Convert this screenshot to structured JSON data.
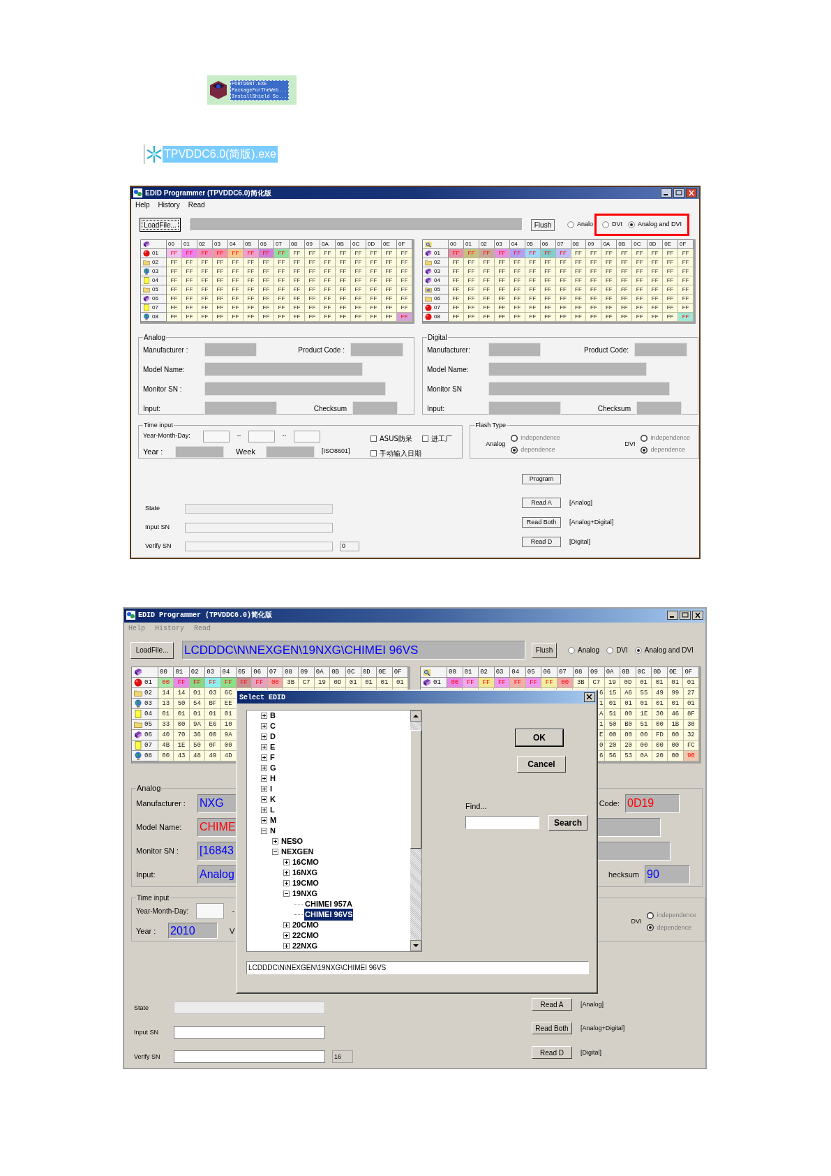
{
  "files": [
    {
      "kind": "package",
      "lines": [
        "PORT96NT.EXE",
        "PackageForTheWeb...",
        "InstallShield So..."
      ],
      "selected": true
    },
    {
      "kind": "app",
      "lines": [
        "TPVDDC6.0(简版).exe"
      ],
      "selected": true
    }
  ],
  "windows": [
    {
      "title": "EDID Programmer (TPVDDC6.0)简化版",
      "menu": [
        {
          "label": "Help",
          "disabled": false
        },
        {
          "label": "History",
          "disabled": false
        },
        {
          "label": "Read",
          "disabled": false
        }
      ],
      "load_button": "LoadFile...",
      "flush_button": "Flush",
      "mode_radios": [
        {
          "label": "Analo",
          "selected": false
        }
      ],
      "highlighted_radios": [
        {
          "label": "DVI",
          "selected": false
        },
        {
          "label": "Analog and DVI",
          "selected": true
        }
      ],
      "grids": [
        {
          "columns": [
            "00",
            "01",
            "02",
            "03",
            "04",
            "05",
            "06",
            "07",
            "08",
            "09",
            "0A",
            "0B",
            "0C",
            "0D",
            "0E",
            "0F"
          ],
          "rows": [
            {
              "label": "01",
              "cells": [
                {
                  "text": "FF",
                  "color": "#f0c0f0"
                },
                {
                  "text": "FF",
                  "color": "#f080f0"
                },
                {
                  "text": "FF",
                  "color": "#f090c0"
                },
                {
                  "text": "FF",
                  "color": "#f890a8"
                },
                {
                  "text": "FF",
                  "color": "#f8c890"
                },
                {
                  "text": "FF",
                  "color": "#f0a0d0"
                },
                {
                  "text": "FF",
                  "color": "#d080d8"
                },
                {
                  "text": "FF",
                  "color": "#90e0a0"
                },
                "FF",
                "FF",
                "FF",
                "FF",
                "FF",
                "FF",
                "FF",
                "FF"
              ]
            },
            {
              "label": "02",
              "cells": [
                "FF",
                "FF",
                "FF",
                "FF",
                "FF",
                "FF",
                "FF",
                "FF",
                "FF",
                "FF",
                "FF",
                "FF",
                "FF",
                "FF",
                "FF",
                "FF"
              ]
            },
            {
              "label": "03",
              "cells": [
                "FF",
                "FF",
                "FF",
                "FF",
                "FF",
                "FF",
                "FF",
                "FF",
                "FF",
                "FF",
                "FF",
                "FF",
                "FF",
                "FF",
                "FF",
                "FF"
              ]
            },
            {
              "label": "04",
              "cells": [
                "FF",
                "FF",
                "FF",
                "FF",
                "FF",
                "FF",
                "FF",
                "FF",
                "FF",
                "FF",
                "FF",
                "FF",
                "FF",
                "FF",
                "FF",
                "FF"
              ]
            },
            {
              "label": "05",
              "cells": [
                "FF",
                "FF",
                "FF",
                "FF",
                "FF",
                "FF",
                "FF",
                "FF",
                "FF",
                "FF",
                "FF",
                "FF",
                "FF",
                "FF",
                "FF",
                "FF"
              ]
            },
            {
              "label": "06",
              "cells": [
                "FF",
                "FF",
                "FF",
                "FF",
                "FF",
                "FF",
                "FF",
                "FF",
                "FF",
                "FF",
                "FF",
                "FF",
                "FF",
                "FF",
                "FF",
                "FF"
              ]
            },
            {
              "label": "07",
              "cells": [
                "FF",
                "FF",
                "FF",
                "FF",
                "FF",
                "FF",
                "FF",
                "FF",
                "FF",
                "FF",
                "FF",
                "FF",
                "FF",
                "FF",
                "FF",
                "FF"
              ]
            },
            {
              "label": "08",
              "cells": [
                "FF",
                "FF",
                "FF",
                "FF",
                "FF",
                "FF",
                "FF",
                "FF",
                "FF",
                "FF",
                "FF",
                "FF",
                "FF",
                "FF",
                "FF",
                {
                  "text": "FF",
                  "color": "#d8a0d8"
                }
              ]
            }
          ]
        },
        {
          "columns": [
            "00",
            "01",
            "02",
            "03",
            "04",
            "05",
            "06",
            "07",
            "08",
            "09",
            "0A",
            "0B",
            "0C",
            "0D",
            "0E",
            "0F"
          ],
          "rows": [
            {
              "label": "01",
              "cells": [
                {
                  "text": "FF",
                  "color": "#e890a8"
                },
                {
                  "text": "FF",
                  "color": "#c8c080"
                },
                {
                  "text": "FF",
                  "color": "#c8a898"
                },
                {
                  "text": "FF",
                  "color": "#e890e0"
                },
                {
                  "text": "FF",
                  "color": "#b0a0f8"
                },
                {
                  "text": "FF",
                  "color": "#a0d8f8"
                },
                {
                  "text": "FF",
                  "color": "#80d0d0"
                },
                {
                  "text": "FF",
                  "color": "#c0c0f8"
                },
                "FF",
                "FF",
                "FF",
                "FF",
                "FF",
                "FF",
                "FF",
                "FF"
              ]
            },
            {
              "label": "02",
              "cells": [
                "FF",
                "FF",
                "FF",
                "FF",
                "FF",
                "FF",
                "FF",
                "FF",
                "FF",
                "FF",
                "FF",
                "FF",
                "FF",
                "FF",
                "FF",
                "FF"
              ]
            },
            {
              "label": "03",
              "cells": [
                "FF",
                "FF",
                "FF",
                "FF",
                "FF",
                "FF",
                "FF",
                "FF",
                "FF",
                "FF",
                "FF",
                "FF",
                "FF",
                "FF",
                "FF",
                "FF"
              ]
            },
            {
              "label": "04",
              "cells": [
                "FF",
                "FF",
                "FF",
                "FF",
                "FF",
                "FF",
                "FF",
                "FF",
                "FF",
                "FF",
                "FF",
                "FF",
                "FF",
                "FF",
                "FF",
                "FF"
              ]
            },
            {
              "label": "05",
              "cells": [
                "FF",
                "FF",
                "FF",
                "FF",
                "FF",
                "FF",
                "FF",
                "FF",
                "FF",
                "FF",
                "FF",
                "FF",
                "FF",
                "FF",
                "FF",
                "FF"
              ]
            },
            {
              "label": "06",
              "cells": [
                "FF",
                "FF",
                "FF",
                "FF",
                "FF",
                "FF",
                "FF",
                "FF",
                "FF",
                "FF",
                "FF",
                "FF",
                "FF",
                "FF",
                "FF",
                "FF"
              ]
            },
            {
              "label": "07",
              "cells": [
                "FF",
                "FF",
                "FF",
                "FF",
                "FF",
                "FF",
                "FF",
                "FF",
                "FF",
                "FF",
                "FF",
                "FF",
                "FF",
                "FF",
                "FF",
                "FF"
              ]
            },
            {
              "label": "08",
              "cells": [
                "FF",
                "FF",
                "FF",
                "FF",
                "FF",
                "FF",
                "FF",
                "FF",
                "FF",
                "FF",
                "FF",
                "FF",
                "FF",
                "FF",
                "FF",
                {
                  "text": "FF",
                  "color": "#a0e8d8"
                }
              ]
            }
          ]
        }
      ],
      "analog": {
        "title": "Analog",
        "manufacturer": {
          "label": "Manufacturer :"
        },
        "product_code": {
          "label": "Product Code :"
        },
        "model_name": {
          "label": "Model Name:"
        },
        "monitor_sn": {
          "label": "Monitor SN :"
        },
        "input": {
          "label": "Input:"
        },
        "checksum": {
          "label": "Checksum"
        }
      },
      "digital": {
        "title": "Digital",
        "manufacturer": {
          "label": "Manufacturer:"
        },
        "product_code": {
          "label": "Product Code:"
        },
        "model_name": {
          "label": "Model Name:"
        },
        "monitor_sn": {
          "label": "Monitor SN"
        },
        "input": {
          "label": "Input:"
        },
        "checksum": {
          "label": "Checksum"
        }
      },
      "time_input": {
        "title": "Time input",
        "ymd_label": "Year-Month-Day:",
        "date_separators": [
          "--",
          "--"
        ],
        "year_label": "Year :",
        "week_label": "Week",
        "iso_label": "[ISO8601]",
        "checkboxes": [
          {
            "label": "ASUS防呆",
            "checked": false
          },
          {
            "label": "进工厂",
            "checked": false
          },
          {
            "label": "手动输入日期",
            "checked": false
          }
        ]
      },
      "flash_type": {
        "title": "Flash Type",
        "groups": [
          {
            "label": "Analog",
            "radios": [
              {
                "label": "independence",
                "selected": false
              },
              {
                "label": "dependence",
                "selected": true
              }
            ]
          },
          {
            "label": "DVI",
            "radios": [
              {
                "label": "independence",
                "selected": false
              },
              {
                "label": "dependence",
                "selected": true
              }
            ]
          }
        ]
      },
      "program_button": "Program",
      "reads": [
        {
          "button": "Read A",
          "note": "[Analog]"
        },
        {
          "button": "Read Both",
          "note": "[Analog+Digital]"
        },
        {
          "button": "Read D",
          "note": "[Digital]"
        }
      ],
      "state_label": "State",
      "input_sn_label": "Input SN",
      "verify_sn_label": "Verify SN",
      "verify_count": "0"
    },
    {
      "title": "EDID Programmer (TPVDDC6.0)简化版",
      "menu": [
        {
          "label": "Help",
          "disabled": true
        },
        {
          "label": "History",
          "disabled": true
        },
        {
          "label": "Read",
          "disabled": true
        }
      ],
      "load_button": "LoadFile...",
      "path_value": "LCDDDC\\N\\NEXGEN\\19NXG\\CHIMEI 96VS",
      "flush_button": "Flush",
      "mode_radios": [
        {
          "label": "Analog",
          "selected": false
        },
        {
          "label": "DVI",
          "selected": false
        },
        {
          "label": "Analog and DVI",
          "selected": true
        }
      ],
      "grids": [
        {
          "columns": [
            "00",
            "01",
            "02",
            "03",
            "04",
            "05",
            "06",
            "07",
            "08",
            "09",
            "0A",
            "0B",
            "0C",
            "0D",
            "0E",
            "0F"
          ],
          "rows": [
            {
              "label": "01",
              "cells": [
                {
                  "text": "00",
                  "color": "#a8e8a8"
                },
                {
                  "text": "FF",
                  "color": "#e888e8"
                },
                {
                  "text": "FF",
                  "color": "#88d888"
                },
                {
                  "text": "FF",
                  "color": "#90f0f0"
                },
                {
                  "text": "FF",
                  "color": "#88e088"
                },
                {
                  "text": "FF",
                  "color": "#c89090"
                },
                {
                  "text": "FF",
                  "color": "#e8a0c0"
                },
                {
                  "text": "00",
                  "color": "#f0a8a8"
                },
                "3B",
                "C7",
                "19",
                "0D",
                "01",
                "01",
                "01",
                "01"
              ]
            },
            {
              "label": "02",
              "cells": [
                "14",
                "14",
                "01",
                "03",
                "6C",
                null,
                null,
                null,
                null,
                null,
                null,
                null,
                null,
                null,
                null,
                null
              ]
            },
            {
              "label": "03",
              "cells": [
                "13",
                "50",
                "54",
                "BF",
                "EE",
                null,
                null,
                null,
                null,
                null,
                null,
                null,
                null,
                null,
                null,
                null
              ]
            },
            {
              "label": "04",
              "cells": [
                "01",
                "01",
                "01",
                "01",
                "01",
                null,
                null,
                null,
                null,
                null,
                null,
                null,
                null,
                null,
                null,
                null
              ]
            },
            {
              "label": "05",
              "cells": [
                "33",
                "00",
                "9A",
                "E6",
                "10",
                null,
                null,
                null,
                null,
                null,
                null,
                null,
                null,
                null,
                null,
                null
              ]
            },
            {
              "label": "06",
              "cells": [
                "40",
                "70",
                "36",
                "00",
                "9A",
                null,
                null,
                null,
                null,
                null,
                null,
                null,
                null,
                null,
                null,
                null
              ]
            },
            {
              "label": "07",
              "cells": [
                "4B",
                "1E",
                "50",
                "0F",
                "00",
                null,
                null,
                null,
                null,
                null,
                null,
                null,
                null,
                null,
                null,
                null
              ]
            },
            {
              "label": "08",
              "cells": [
                "00",
                "43",
                "48",
                "49",
                "4D",
                null,
                null,
                null,
                null,
                null,
                null,
                null,
                null,
                null,
                null,
                null
              ]
            }
          ]
        },
        {
          "columns": [
            "00",
            "01",
            "02",
            "03",
            "04",
            "05",
            "06",
            "07",
            "08",
            "09",
            "0A",
            "0B",
            "0C",
            "0D",
            "0E",
            "0F"
          ],
          "rows": [
            {
              "label": "01",
              "cells": [
                {
                  "text": "00",
                  "color": "#e888e8"
                },
                {
                  "text": "FF",
                  "color": "#f0a8f0"
                },
                {
                  "text": "FF",
                  "color": "#f0e890"
                },
                {
                  "text": "FF",
                  "color": "#f098f0"
                },
                {
                  "text": "FF",
                  "color": "#f0b0a8"
                },
                {
                  "text": "FF",
                  "color": "#f098f0"
                },
                {
                  "text": "FF",
                  "color": "#f0f0a0"
                },
                {
                  "text": "00",
                  "color": "#f0a8a8"
                },
                "3B",
                "C7",
                "19",
                "0D",
                "01",
                "01",
                "01",
                "01"
              ]
            },
            {
              "cells": [
                null,
                null,
                null,
                null,
                null,
                null,
                null,
                null,
                null,
                {
                  "text": "6",
                  "partial": true
                },
                "15",
                "A6",
                "55",
                "49",
                "99",
                "27"
              ]
            },
            {
              "cells": [
                null,
                null,
                null,
                null,
                null,
                null,
                null,
                null,
                null,
                {
                  "text": "1",
                  "partial": true
                },
                "01",
                "01",
                "01",
                "01",
                "01",
                "01"
              ]
            },
            {
              "cells": [
                null,
                null,
                null,
                null,
                null,
                null,
                null,
                null,
                null,
                {
                  "text": "A",
                  "partial": true
                },
                "51",
                "00",
                "1E",
                "30",
                "46",
                "8F"
              ]
            },
            {
              "cells": [
                null,
                null,
                null,
                null,
                null,
                null,
                null,
                null,
                null,
                {
                  "text": "1",
                  "partial": true
                },
                "50",
                "B0",
                "51",
                "00",
                "1B",
                "30"
              ]
            },
            {
              "cells": [
                null,
                null,
                null,
                null,
                null,
                null,
                null,
                null,
                null,
                {
                  "text": "E",
                  "partial": true
                },
                "00",
                "00",
                "00",
                "FD",
                "00",
                "32"
              ]
            },
            {
              "cells": [
                null,
                null,
                null,
                null,
                null,
                null,
                null,
                null,
                null,
                {
                  "text": "0",
                  "partial": true
                },
                "20",
                "20",
                "00",
                "00",
                "00",
                "FC"
              ]
            },
            {
              "cells": [
                null,
                null,
                null,
                null,
                null,
                null,
                null,
                null,
                null,
                {
                  "text": "6",
                  "partial": true
                },
                "56",
                "53",
                "0A",
                "20",
                "00",
                {
                  "text": "90",
                  "color": "#f0c8b0"
                }
              ]
            }
          ]
        }
      ],
      "analog": {
        "title": "Analog",
        "manufacturer": {
          "label": "Manufacturer :",
          "value": "NXG",
          "color": "#0000ff"
        },
        "model_name": {
          "label": "Model Name:",
          "value": "CHIME",
          "color": "#ff0000"
        },
        "monitor_sn": {
          "label": "Monitor SN :",
          "value": "[16843",
          "color": "#0000ff"
        },
        "input": {
          "label": "Input:",
          "value": "Analog",
          "color": "#0000ff"
        }
      },
      "digital": {
        "product_code": {
          "label": "Code:",
          "value": "0D19",
          "color": "#ff0000"
        },
        "checksum": {
          "label": "hecksum",
          "value": "90",
          "color": "#0000ff"
        }
      },
      "time_input": {
        "title": "Time input",
        "ymd_label": "Year-Month-Day:",
        "date_separators": [
          "-"
        ],
        "year_label": "Year :",
        "year": {
          "value": "2010",
          "color": "#0000ff"
        },
        "week_label": "V"
      },
      "flash_type": {
        "groups": [
          {
            "label": "DVI",
            "radios": [
              {
                "label": "independence",
                "selected": false
              },
              {
                "label": "dependence",
                "selected": true
              }
            ]
          }
        ]
      },
      "reads": [
        {
          "button": "Read A",
          "note": "[Analog]"
        },
        {
          "button": "Read Both",
          "note": "[Analog+Digital]"
        },
        {
          "button": "Read D",
          "note": "[Digital]"
        }
      ],
      "state_label": "State",
      "input_sn_label": "Input SN",
      "verify_sn_label": "Verify SN",
      "verify_count": "16",
      "dialog": {
        "title": "Select EDID",
        "tree": [
          {
            "label": "B",
            "expanded": false,
            "selected": false
          },
          {
            "label": "C",
            "expanded": false,
            "selected": false
          },
          {
            "label": "D",
            "expanded": false,
            "selected": false
          },
          {
            "label": "E",
            "expanded": false,
            "selected": false
          },
          {
            "label": "F",
            "expanded": false,
            "selected": false
          },
          {
            "label": "G",
            "expanded": false,
            "selected": false
          },
          {
            "label": "H",
            "expanded": false,
            "selected": false
          },
          {
            "label": "I",
            "expanded": false,
            "selected": false
          },
          {
            "label": "K",
            "expanded": false,
            "selected": false
          },
          {
            "label": "L",
            "expanded": false,
            "selected": false
          },
          {
            "label": "M",
            "expanded": false,
            "selected": false
          },
          {
            "label": "N",
            "expanded": true,
            "selected": false,
            "children": [
              {
                "label": "NESO",
                "expanded": false,
                "selected": false
              },
              {
                "label": "NEXGEN",
                "expanded": true,
                "selected": false,
                "children": [
                  {
                    "label": "16CMO",
                    "expanded": false,
                    "selected": false
                  },
                  {
                    "label": "16NXG",
                    "expanded": false,
                    "selected": false
                  },
                  {
                    "label": "19CMO",
                    "expanded": false,
                    "selected": false
                  },
                  {
                    "label": "19NXG",
                    "expanded": true,
                    "selected": false,
                    "children": [
                      {
                        "label": "CHIMEI 957A",
                        "selected": false
                      },
                      {
                        "label": "CHIMEI 96VS",
                        "selected": true
                      }
                    ]
                  },
                  {
                    "label": "20CMO",
                    "expanded": false,
                    "selected": false
                  },
                  {
                    "label": "22CMO",
                    "expanded": false,
                    "selected": false
                  },
                  {
                    "label": "22NXG",
                    "expanded": false,
                    "selected": false
                  }
                ]
              }
            ]
          }
        ],
        "ok_button": "OK",
        "cancel_button": "Cancel",
        "find_label": "Find...",
        "search_button": "Search",
        "path_value": "LCDDDC\\N\\NEXGEN\\19NXG\\CHIMEI 96VS"
      }
    }
  ]
}
